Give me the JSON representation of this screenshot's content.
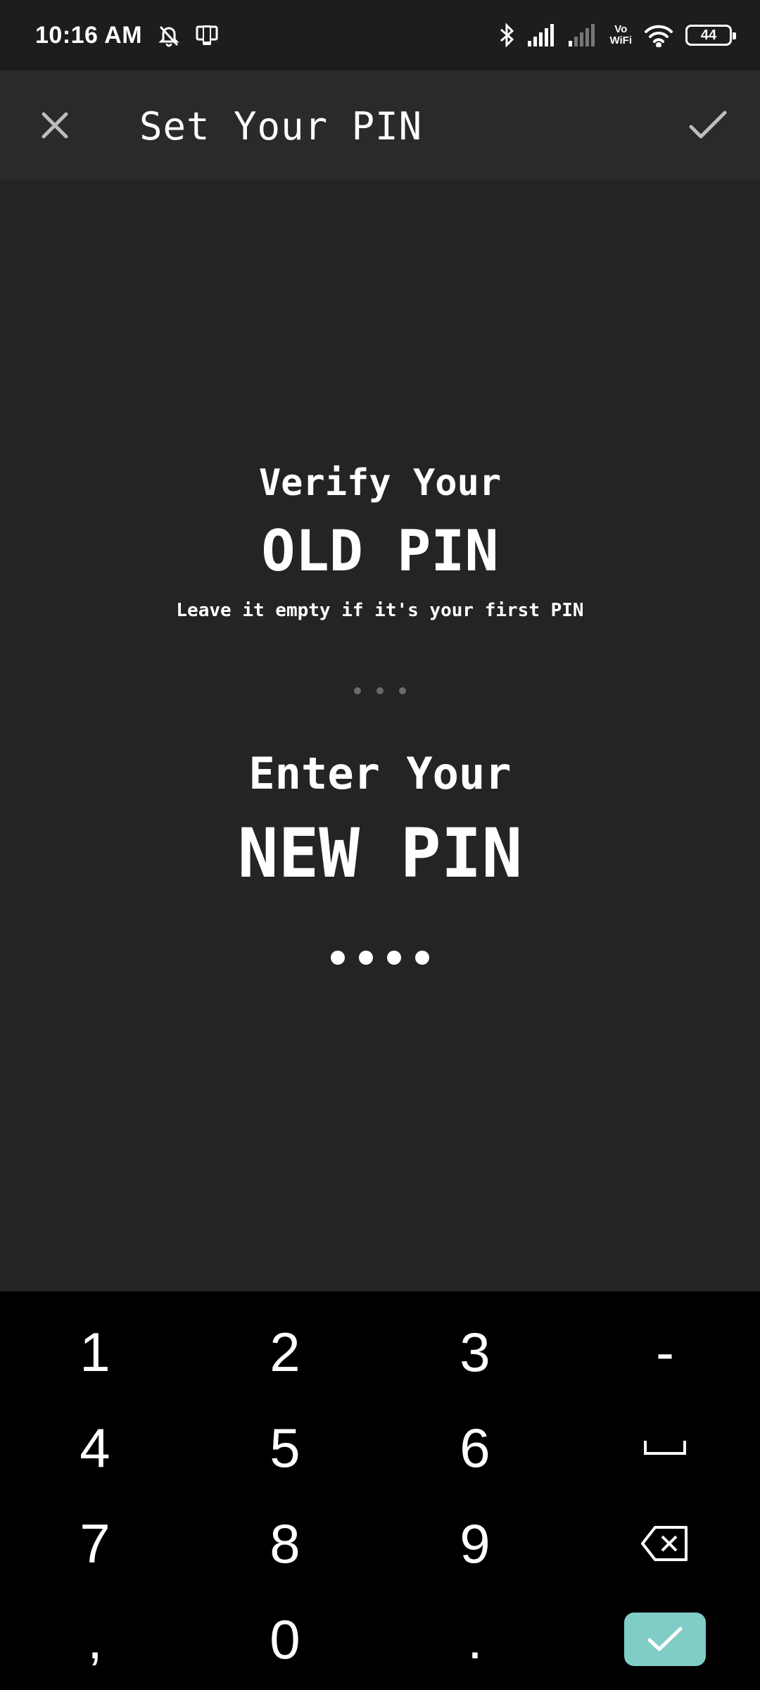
{
  "status_bar": {
    "time": "10:16 AM",
    "vowifi_top": "Vo",
    "vowifi_bottom": "WiFi",
    "battery": "44",
    "icons": [
      "mute-icon",
      "device-icon",
      "bluetooth-icon",
      "signal-icon",
      "signal-weak-icon",
      "wifi-icon",
      "battery-icon"
    ]
  },
  "app_bar": {
    "title": "Set Your PIN",
    "close_icon": "close-icon",
    "confirm_icon": "check-icon"
  },
  "old_pin": {
    "heading": "Verify Your",
    "title": "OLD PIN",
    "hint": "Leave it empty if it's your first PIN"
  },
  "new_pin": {
    "heading": "Enter Your",
    "title": "NEW PIN",
    "entered_digits": 4
  },
  "keypad": {
    "keys": [
      "1",
      "2",
      "3",
      "-",
      "4",
      "5",
      "6",
      "␣",
      "7",
      "8",
      "9",
      "⌫",
      ",",
      "0",
      "."
    ],
    "done_color": "#7fcdc6"
  },
  "colors": {
    "background": "#242424",
    "app_bar": "#2a2a2a",
    "keypad": "#000000",
    "accent": "#7fcdc6"
  }
}
